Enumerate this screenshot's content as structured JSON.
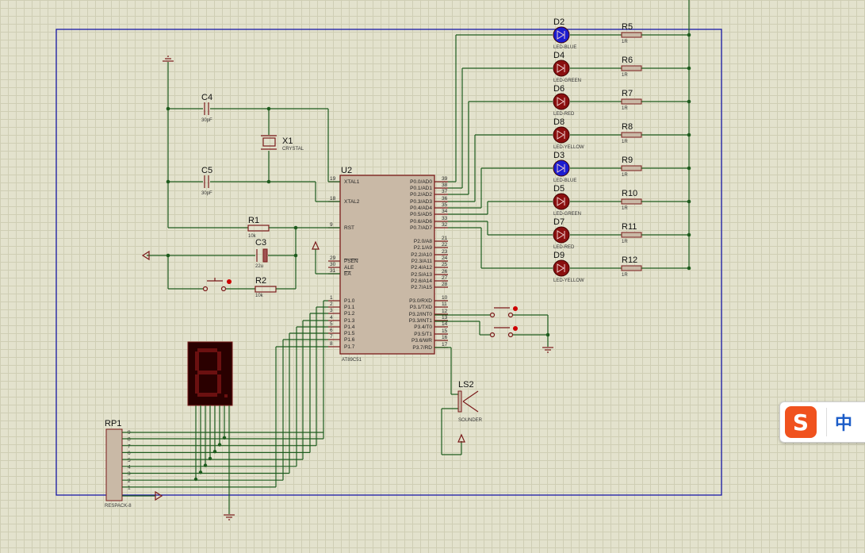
{
  "chip": {
    "ref": "U2",
    "part": "AT89C51",
    "left_pins": [
      {
        "num": "19",
        "name": "XTAL1"
      },
      {
        "num": "18",
        "name": "XTAL2"
      },
      {
        "num": "9",
        "name": "RST"
      },
      {
        "num": "29",
        "name": "PSEN"
      },
      {
        "num": "30",
        "name": "ALE"
      },
      {
        "num": "31",
        "name": "EA"
      },
      {
        "num": "1",
        "name": "P1.0"
      },
      {
        "num": "2",
        "name": "P1.1"
      },
      {
        "num": "3",
        "name": "P1.2"
      },
      {
        "num": "4",
        "name": "P1.3"
      },
      {
        "num": "5",
        "name": "P1.4"
      },
      {
        "num": "6",
        "name": "P1.5"
      },
      {
        "num": "7",
        "name": "P1.6"
      },
      {
        "num": "8",
        "name": "P1.7"
      }
    ],
    "right_pins": [
      {
        "num": "39",
        "name": "P0.0/AD0"
      },
      {
        "num": "38",
        "name": "P0.1/AD1"
      },
      {
        "num": "37",
        "name": "P0.2/AD2"
      },
      {
        "num": "36",
        "name": "P0.3/AD3"
      },
      {
        "num": "35",
        "name": "P0.4/AD4"
      },
      {
        "num": "34",
        "name": "P0.5/AD5"
      },
      {
        "num": "33",
        "name": "P0.6/AD6"
      },
      {
        "num": "32",
        "name": "P0.7/AD7"
      },
      {
        "num": "21",
        "name": "P2.0/A8"
      },
      {
        "num": "22",
        "name": "P2.1/A9"
      },
      {
        "num": "23",
        "name": "P2.2/A10"
      },
      {
        "num": "24",
        "name": "P2.3/A11"
      },
      {
        "num": "25",
        "name": "P2.4/A12"
      },
      {
        "num": "26",
        "name": "P2.5/A13"
      },
      {
        "num": "27",
        "name": "P2.6/A14"
      },
      {
        "num": "28",
        "name": "P2.7/A15"
      },
      {
        "num": "10",
        "name": "P3.0/RXD"
      },
      {
        "num": "11",
        "name": "P3.1/TXD"
      },
      {
        "num": "12",
        "name": "P3.2/INT0"
      },
      {
        "num": "13",
        "name": "P3.3/INT1"
      },
      {
        "num": "14",
        "name": "P3.4/T0"
      },
      {
        "num": "15",
        "name": "P3.5/T1"
      },
      {
        "num": "16",
        "name": "P3.6/WR"
      },
      {
        "num": "17",
        "name": "P3.7/RD"
      }
    ]
  },
  "leds": [
    {
      "ref": "D2",
      "type": "LED-BLUE",
      "color": "#1c1cd0"
    },
    {
      "ref": "D4",
      "type": "LED-GREEN",
      "color": "#8a0f0f"
    },
    {
      "ref": "D6",
      "type": "LED-RED",
      "color": "#8a0f0f"
    },
    {
      "ref": "D8",
      "type": "LED-YELLOW",
      "color": "#8a0f0f"
    },
    {
      "ref": "D3",
      "type": "LED-BLUE",
      "color": "#1c1cd0"
    },
    {
      "ref": "D5",
      "type": "LED-GREEN",
      "color": "#8a0f0f"
    },
    {
      "ref": "D7",
      "type": "LED-RED",
      "color": "#8a0f0f"
    },
    {
      "ref": "D9",
      "type": "LED-YELLOW",
      "color": "#8a0f0f"
    }
  ],
  "led_resistors": [
    {
      "ref": "R5",
      "value": "1R"
    },
    {
      "ref": "R6",
      "value": "1R"
    },
    {
      "ref": "R7",
      "value": "1R"
    },
    {
      "ref": "R8",
      "value": "1R"
    },
    {
      "ref": "R9",
      "value": "1R"
    },
    {
      "ref": "R10",
      "value": "1R"
    },
    {
      "ref": "R11",
      "value": "1R"
    },
    {
      "ref": "R12",
      "value": "1R"
    }
  ],
  "c4": {
    "ref": "C4",
    "value": "30pF"
  },
  "c5": {
    "ref": "C5",
    "value": "30pF"
  },
  "x1": {
    "ref": "X1",
    "value": "CRYSTAL"
  },
  "r1": {
    "ref": "R1",
    "value": "10k"
  },
  "c3": {
    "ref": "C3",
    "value": "22u"
  },
  "r2": {
    "ref": "R2",
    "value": "10k"
  },
  "ls2": {
    "ref": "LS2",
    "value": "SOUNDER"
  },
  "rp1": {
    "ref": "RP1",
    "value": "RESPACK-8",
    "pins": [
      "9",
      "8",
      "7",
      "6",
      "5",
      "4",
      "3",
      "2",
      "1"
    ]
  },
  "seg_display": {
    "segment_color": "#6b1010",
    "body_color": "#2a0000"
  },
  "ime": {
    "logo": "S",
    "lang": "中"
  },
  "colors": {
    "wire": "#1e5c1e",
    "component": "#7a1a1a",
    "chip_fill": "#c9b9a6",
    "border": "#1a1aa8",
    "background": "#e3e2cd"
  }
}
